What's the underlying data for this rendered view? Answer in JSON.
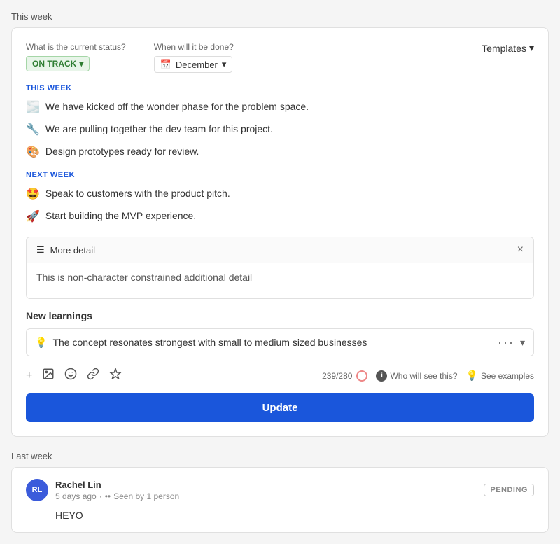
{
  "thisWeek": {
    "sectionLabel": "This week",
    "statusField": {
      "label": "What is the current status?",
      "value": "ON TRACK",
      "chevron": "▾"
    },
    "dateField": {
      "label": "When will it be done?",
      "icon": "📅",
      "value": "December",
      "chevron": "▾"
    },
    "templates": {
      "label": "Templates",
      "chevron": "▾"
    },
    "thisWeekHeading": "THIS WEEK",
    "thisWeekItems": [
      {
        "emoji": "🌫️",
        "text": "We have kicked off the wonder phase for the problem space."
      },
      {
        "emoji": "🔧",
        "text": "We are pulling together the dev team for this project."
      },
      {
        "emoji": "🎨",
        "text": "Design prototypes ready for review."
      }
    ],
    "nextWeekHeading": "NEXT WEEK",
    "nextWeekItems": [
      {
        "emoji": "🤩",
        "text": "Speak to customers with the product pitch."
      },
      {
        "emoji": "🚀",
        "text": "Start building the MVP experience."
      }
    ],
    "moreDetail": {
      "icon": "☰",
      "title": "More detail",
      "closeIcon": "×",
      "bodyText": "This is non-character constrained additional detail"
    },
    "newLearnings": {
      "label": "New learnings",
      "item": {
        "emoji": "💡",
        "text": "The concept resonates strongest with small to medium sized businesses"
      }
    },
    "toolbar": {
      "addIcon": "+",
      "imageIcon": "🖼",
      "emojiIcon": "😊",
      "linkIcon": "🔗",
      "sparkleIcon": "✦",
      "charCount": "239/280",
      "whoLabel": "Who will see this?",
      "examplesLabel": "See examples"
    },
    "updateButton": "Update"
  },
  "lastWeek": {
    "sectionLabel": "Last week",
    "post": {
      "authorInitials": "RL",
      "authorName": "Rachel Lin",
      "meta": "5 days ago",
      "dots": "••",
      "seenBy": "Seen by 1 person",
      "pendingBadge": "PENDING",
      "content": "HEYO"
    }
  }
}
